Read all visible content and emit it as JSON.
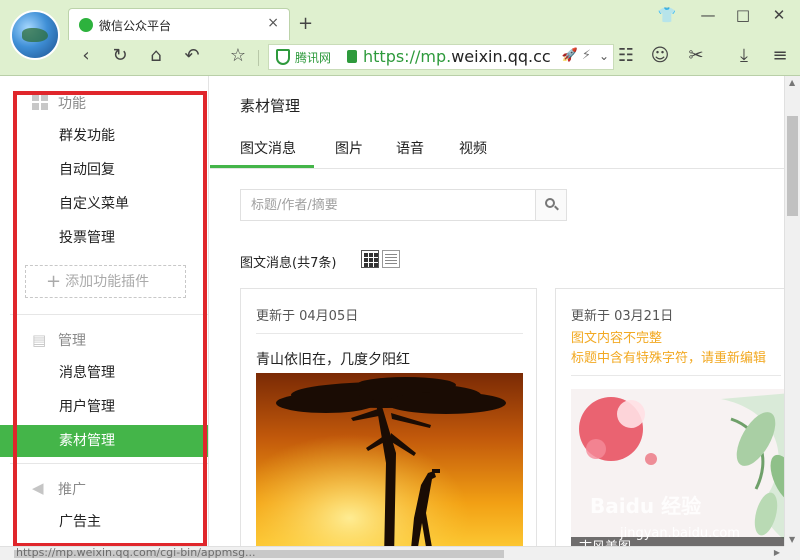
{
  "browser": {
    "tab_title": "微信公众平台",
    "tab_close": "×",
    "new_tab": "+",
    "url_provider": "腾讯网",
    "url_scheme": "https://mp.",
    "url_domain": "weixin.qq.cc",
    "url_icons": "🚀 ⚡",
    "icons": [
      "logo-icon",
      "wechat-icon",
      "back-icon",
      "refresh-icon",
      "home-icon",
      "undo-icon",
      "star-icon",
      "shield-icon",
      "lock-icon",
      "grid-apps-icon",
      "frog-icon",
      "scissors-icon",
      "download-icon",
      "menu-icon",
      "shirt-icon",
      "minimize-icon",
      "maximize-icon",
      "close-icon"
    ]
  },
  "sidebar": {
    "sections": [
      {
        "title": "功能",
        "icon": "grid-icon",
        "items": [
          "群发功能",
          "自动回复",
          "自定义菜单",
          "投票管理"
        ]
      },
      {
        "title": "管理",
        "icon": "inbox-icon",
        "items": [
          "消息管理",
          "用户管理",
          "素材管理"
        ]
      },
      {
        "title": "推广",
        "icon": "megaphone-icon",
        "items": [
          "广告主"
        ]
      }
    ],
    "plugin_button": "添加功能插件",
    "active_item": "素材管理",
    "highlight_color": "#e0262b"
  },
  "main": {
    "title": "素材管理",
    "tabs": [
      "图文消息",
      "图片",
      "语音",
      "视频"
    ],
    "active_tab": "图文消息",
    "search_placeholder": "标题/作者/摘要",
    "count_label": "图文消息(共7条)",
    "cards": [
      {
        "date": "更新于 04月05日",
        "title": "青山依旧在，几度夕阳红"
      },
      {
        "date": "更新于 03月21日",
        "warnings": [
          "图文内容不完整",
          "标题中含有特殊字符，请重新编辑"
        ],
        "caption": "古风美图"
      }
    ],
    "watermark": "Baidu 经验",
    "watermark_url": "jingyan.baidu.com"
  },
  "status_url": "https://mp.weixin.qq.com/cgi-bin/appmsg...",
  "accent": "#44b549",
  "warn_color": "#f2a922"
}
